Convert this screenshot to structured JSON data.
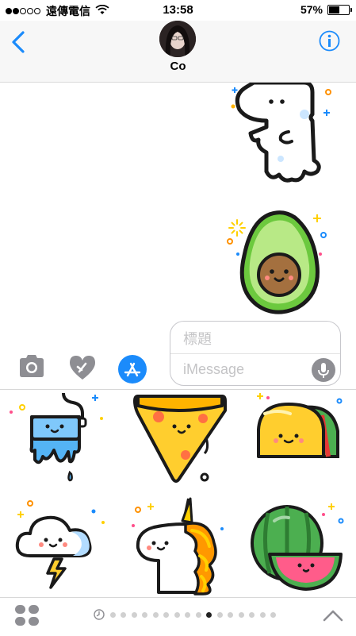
{
  "status_bar": {
    "carrier": "遠傳電信",
    "time": "13:58",
    "battery": "57%",
    "battery_level": 0.57
  },
  "header": {
    "contact_name": "Co"
  },
  "composer": {
    "subject_placeholder": "標題",
    "message_placeholder": "iMessage"
  },
  "sticker_drawer": {
    "stickers": [
      {
        "name": "paint-bucket-sticker"
      },
      {
        "name": "pizza-slice-sticker"
      },
      {
        "name": "taco-sticker"
      },
      {
        "name": "rain-cloud-sticker"
      },
      {
        "name": "unicorn-sticker"
      },
      {
        "name": "watermelon-sticker"
      }
    ]
  },
  "pager": {
    "page_count": 16,
    "active_page": 10
  },
  "colors": {
    "ios_blue": "#1b8bfb",
    "avocado_green": "#7ed957",
    "sticker_yellow": "#ffd000"
  }
}
